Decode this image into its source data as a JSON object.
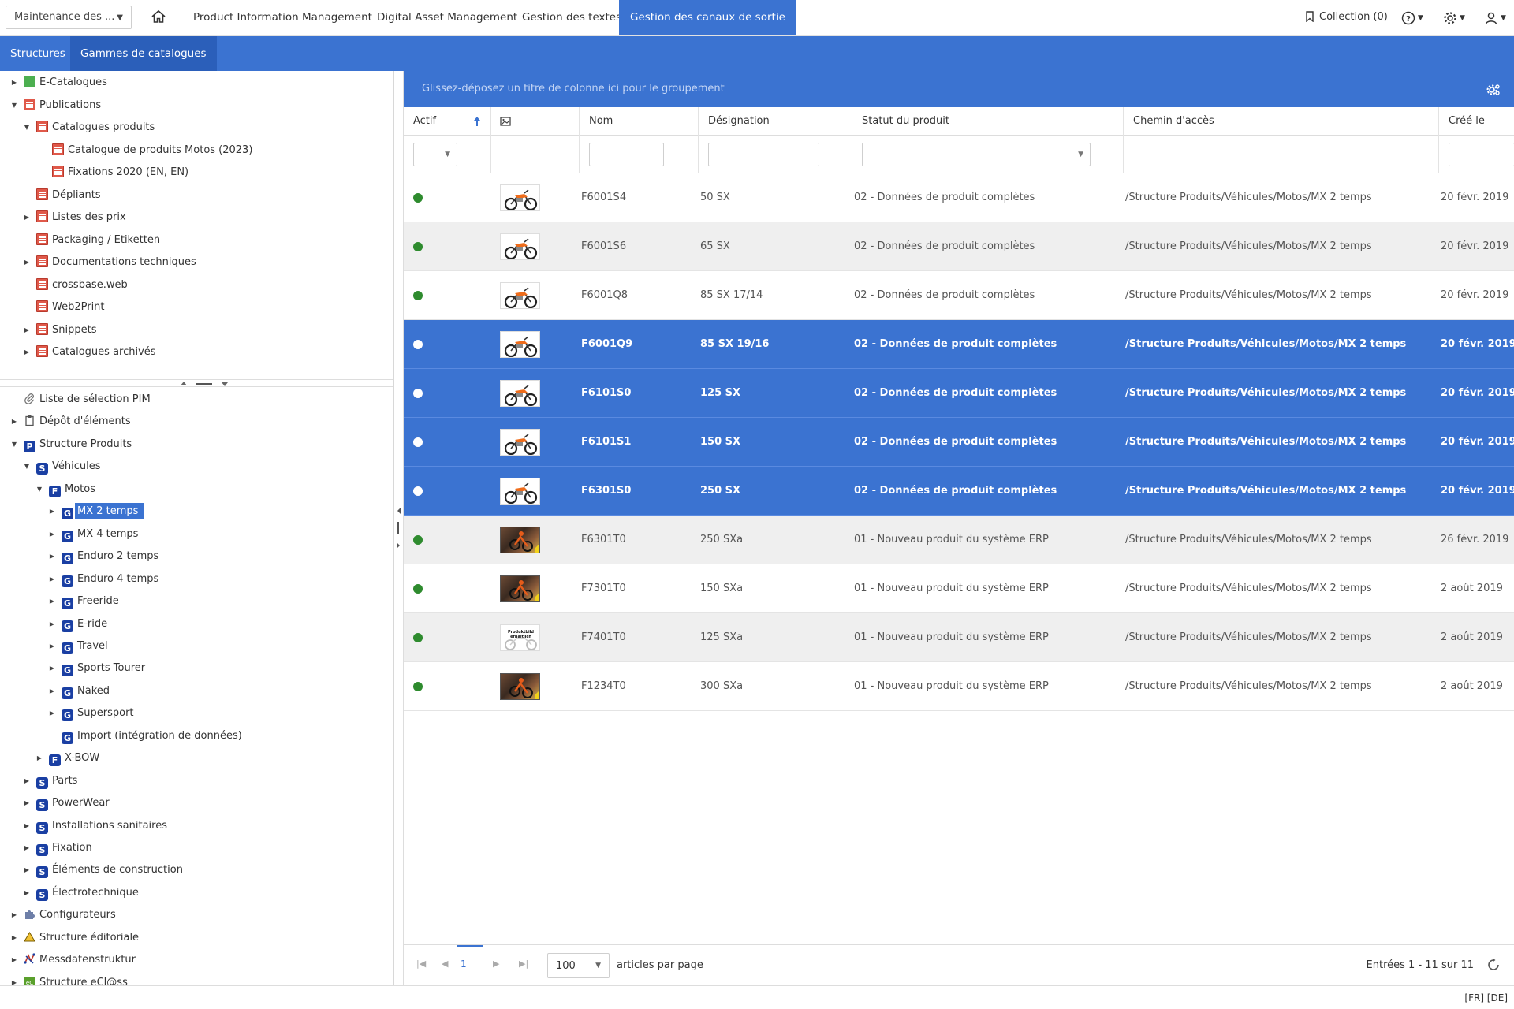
{
  "topbar": {
    "module_select": "Maintenance des ...",
    "nav": [
      {
        "label": "Product Information Management",
        "active": false
      },
      {
        "label": "Digital Asset Management",
        "active": false
      },
      {
        "label": "Gestion des textes",
        "active": false
      },
      {
        "label": "Gestion des canaux de sortie",
        "active": true
      }
    ],
    "collection": "Collection (0)",
    "icons": [
      "home-icon",
      "bookmark-icon",
      "help-icon",
      "gear-icon",
      "user-icon"
    ]
  },
  "subbar": {
    "tabs": [
      {
        "label": "Structures",
        "active": false
      },
      {
        "label": "Gammes de catalogues",
        "active": true
      }
    ]
  },
  "tree_top": [
    {
      "label": "E-Catalogues",
      "toggle": "right",
      "icon": "green-book-icon"
    },
    {
      "label": "Publications",
      "toggle": "down",
      "icon": "publication-icon"
    },
    {
      "label": "Catalogues produits",
      "toggle": "down",
      "icon": "publication-icon"
    },
    {
      "label": "Catalogue de produits Motos (2023)",
      "toggle": "",
      "icon": "publication-icon"
    },
    {
      "label": "Fixations 2020 (EN, EN)",
      "toggle": "",
      "icon": "publication-icon"
    },
    {
      "label": "Dépliants",
      "toggle": "",
      "icon": "publication-icon"
    },
    {
      "label": "Listes des prix",
      "toggle": "right",
      "icon": "publication-icon"
    },
    {
      "label": "Packaging / Etiketten",
      "toggle": "",
      "icon": "publication-icon"
    },
    {
      "label": "Documentations techniques",
      "toggle": "right",
      "icon": "publication-icon"
    },
    {
      "label": "crossbase.web",
      "toggle": "",
      "icon": "publication-icon"
    },
    {
      "label": "Web2Print",
      "toggle": "",
      "icon": "publication-icon"
    },
    {
      "label": "Snippets",
      "toggle": "right",
      "icon": "publication-icon"
    },
    {
      "label": "Catalogues archivés",
      "toggle": "right",
      "icon": "publication-icon"
    }
  ],
  "tree_bottom": [
    {
      "label": "Liste de sélection PIM",
      "toggle": "",
      "icon": "paperclip-icon",
      "letter": ""
    },
    {
      "label": "Dépôt d'éléments",
      "toggle": "right",
      "icon": "clipboard-icon",
      "letter": ""
    },
    {
      "label": "Structure Produits",
      "toggle": "down",
      "icon": "letter-icon",
      "letter": "P"
    },
    {
      "label": "Véhicules",
      "toggle": "down",
      "icon": "letter-icon",
      "letter": "S"
    },
    {
      "label": "Motos",
      "toggle": "down",
      "icon": "letter-icon",
      "letter": "F"
    },
    {
      "label": "MX 2 temps",
      "toggle": "right",
      "icon": "letter-icon",
      "letter": "G",
      "selected": true
    },
    {
      "label": "MX 4 temps",
      "toggle": "right",
      "icon": "letter-icon",
      "letter": "G"
    },
    {
      "label": "Enduro 2 temps",
      "toggle": "right",
      "icon": "letter-icon",
      "letter": "G"
    },
    {
      "label": "Enduro 4 temps",
      "toggle": "right",
      "icon": "letter-icon",
      "letter": "G"
    },
    {
      "label": "Freeride",
      "toggle": "right",
      "icon": "letter-icon",
      "letter": "G"
    },
    {
      "label": "E-ride",
      "toggle": "right",
      "icon": "letter-icon",
      "letter": "G"
    },
    {
      "label": "Travel",
      "toggle": "right",
      "icon": "letter-icon",
      "letter": "G"
    },
    {
      "label": "Sports Tourer",
      "toggle": "right",
      "icon": "letter-icon",
      "letter": "G"
    },
    {
      "label": "Naked",
      "toggle": "right",
      "icon": "letter-icon",
      "letter": "G"
    },
    {
      "label": "Supersport",
      "toggle": "right",
      "icon": "letter-icon",
      "letter": "G"
    },
    {
      "label": "Import (intégration de données)",
      "toggle": "",
      "icon": "letter-icon",
      "letter": "G"
    },
    {
      "label": "X-BOW",
      "toggle": "right",
      "icon": "letter-icon",
      "letter": "F"
    },
    {
      "label": "Parts",
      "toggle": "right",
      "icon": "letter-icon",
      "letter": "S"
    },
    {
      "label": "PowerWear",
      "toggle": "right",
      "icon": "letter-icon",
      "letter": "S"
    },
    {
      "label": "Installations sanitaires",
      "toggle": "right",
      "icon": "letter-icon",
      "letter": "S"
    },
    {
      "label": "Fixation",
      "toggle": "right",
      "icon": "letter-icon",
      "letter": "S"
    },
    {
      "label": "Éléments de construction",
      "toggle": "right",
      "icon": "letter-icon",
      "letter": "S"
    },
    {
      "label": "Électrotechnique",
      "toggle": "right",
      "icon": "letter-icon",
      "letter": "S"
    },
    {
      "label": "Configurateurs",
      "toggle": "right",
      "icon": "puzzle-icon",
      "letter": ""
    },
    {
      "label": "Structure éditoriale",
      "toggle": "right",
      "icon": "triangle-icon",
      "letter": ""
    },
    {
      "label": "Messdatenstruktur",
      "toggle": "right",
      "icon": "network-icon",
      "letter": ""
    },
    {
      "label": "Structure eCl@ss",
      "toggle": "right",
      "icon": "eclass-icon",
      "letter": ""
    }
  ],
  "grid": {
    "group_hint": "Glissez-déposez un titre de colonne ici pour le groupement",
    "columns": [
      "Actif",
      "",
      "Nom",
      "Désignation",
      "Statut du produit",
      "Chemin d'accès",
      "Créé le"
    ],
    "rows": [
      {
        "active": true,
        "thumb": "bike",
        "name": "F6001S4",
        "designation": "50 SX",
        "status": "02 - Données de produit complètes",
        "path": "/Structure Produits/Véhicules/Motos/MX 2 temps",
        "created": "20 févr. 2019",
        "selected": false
      },
      {
        "active": true,
        "thumb": "bike",
        "name": "F6001S6",
        "designation": "65 SX",
        "status": "02 - Données de produit complètes",
        "path": "/Structure Produits/Véhicules/Motos/MX 2 temps",
        "created": "20 févr. 2019",
        "selected": false
      },
      {
        "active": true,
        "thumb": "bike",
        "name": "F6001Q8",
        "designation": "85 SX 17/14",
        "status": "02 - Données de produit complètes",
        "path": "/Structure Produits/Véhicules/Motos/MX 2 temps",
        "created": "20 févr. 2019",
        "selected": false
      },
      {
        "active": true,
        "thumb": "bike",
        "name": "F6001Q9",
        "designation": "85 SX 19/16",
        "status": "02 - Données de produit complètes",
        "path": "/Structure Produits/Véhicules/Motos/MX 2 temps",
        "created": "20 févr. 2019",
        "selected": true
      },
      {
        "active": true,
        "thumb": "bike",
        "name": "F6101S0",
        "designation": "125 SX",
        "status": "02 - Données de produit complètes",
        "path": "/Structure Produits/Véhicules/Motos/MX 2 temps",
        "created": "20 févr. 2019",
        "selected": true
      },
      {
        "active": true,
        "thumb": "bike",
        "name": "F6101S1",
        "designation": "150 SX",
        "status": "02 - Données de produit complètes",
        "path": "/Structure Produits/Véhicules/Motos/MX 2 temps",
        "created": "20 févr. 2019",
        "selected": true
      },
      {
        "active": true,
        "thumb": "bike",
        "name": "F6301S0",
        "designation": "250 SX",
        "status": "02 - Données de produit complètes",
        "path": "/Structure Produits/Véhicules/Motos/MX 2 temps",
        "created": "20 févr. 2019",
        "selected": true
      },
      {
        "active": true,
        "thumb": "photo",
        "name": "F6301T0",
        "designation": "250 SXa",
        "status": "01 - Nouveau produit du système ERP",
        "path": "/Structure Produits/Véhicules/Motos/MX 2 temps",
        "created": "26 févr. 2019",
        "selected": false
      },
      {
        "active": true,
        "thumb": "photo",
        "name": "F7301T0",
        "designation": "150 SXa",
        "status": "01 - Nouveau produit du système ERP",
        "path": "/Structure Produits/Véhicules/Motos/MX 2 temps",
        "created": "2 août 2019",
        "selected": false
      },
      {
        "active": true,
        "thumb": "text",
        "name": "F7401T0",
        "designation": "125 SXa",
        "status": "01 - Nouveau produit du système ERP",
        "path": "/Structure Produits/Véhicules/Motos/MX 2 temps",
        "created": "2 août 2019",
        "selected": false
      },
      {
        "active": true,
        "thumb": "photo",
        "name": "F1234T0",
        "designation": "300 SXa",
        "status": "01 - Nouveau produit du système ERP",
        "path": "/Structure Produits/Véhicules/Motos/MX 2 temps",
        "created": "2 août 2019",
        "selected": false
      }
    ],
    "thumb_text": "Produktbild erhältlich"
  },
  "pager": {
    "page": "1",
    "page_size": "100",
    "per_page_label": "articles par page",
    "entries": "Entrées 1 - 11 sur 11"
  },
  "footer": {
    "languages": "[FR] [DE]"
  },
  "colors": {
    "accent": "#3b73d1",
    "accent_dark": "#2b5fba",
    "active_dot": "#2e8b2e",
    "publication": "#e0594a",
    "tree_letter": "#1a3fa3"
  }
}
